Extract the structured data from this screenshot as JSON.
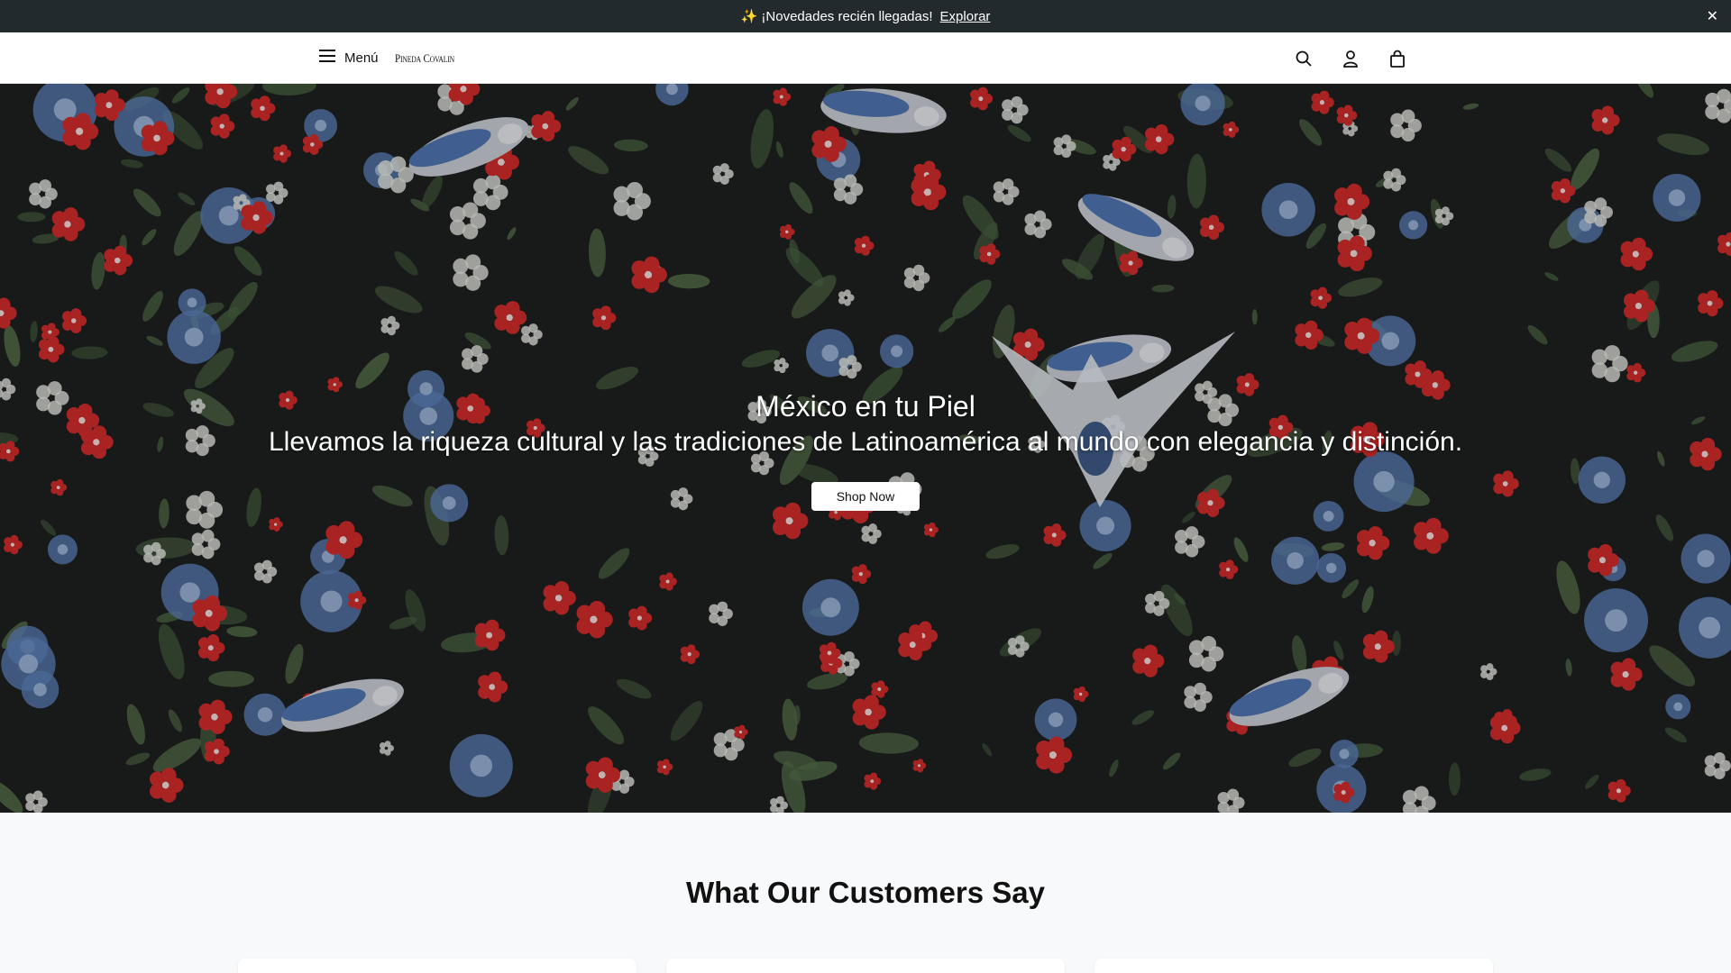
{
  "announcement": {
    "text": "✨ ¡Novedades recién llegadas!",
    "link": "Explorar",
    "close": "✕"
  },
  "header": {
    "menu_label": "Menú",
    "logo_text": "Pineda Covalin",
    "icons": [
      "search-icon",
      "account-icon",
      "cart-icon"
    ]
  },
  "hero": {
    "title": "México en tu Piel",
    "subtitle": "Llevamos la riqueza cultural y las tradiciones de Latinoamérica al mundo con elegancia y distinción.",
    "cta": "Shop Now"
  },
  "testimonials": {
    "heading": "What Our Customers Say",
    "cards": 3
  },
  "colors": {
    "announcement_bg": "#232a2e",
    "hero_bg": "#1e2020",
    "flower_red": "#d42a2a",
    "flower_blue": "#5b7fb8",
    "leaf_green": "#4f6b45",
    "section_bg": "#f8f9fa"
  }
}
